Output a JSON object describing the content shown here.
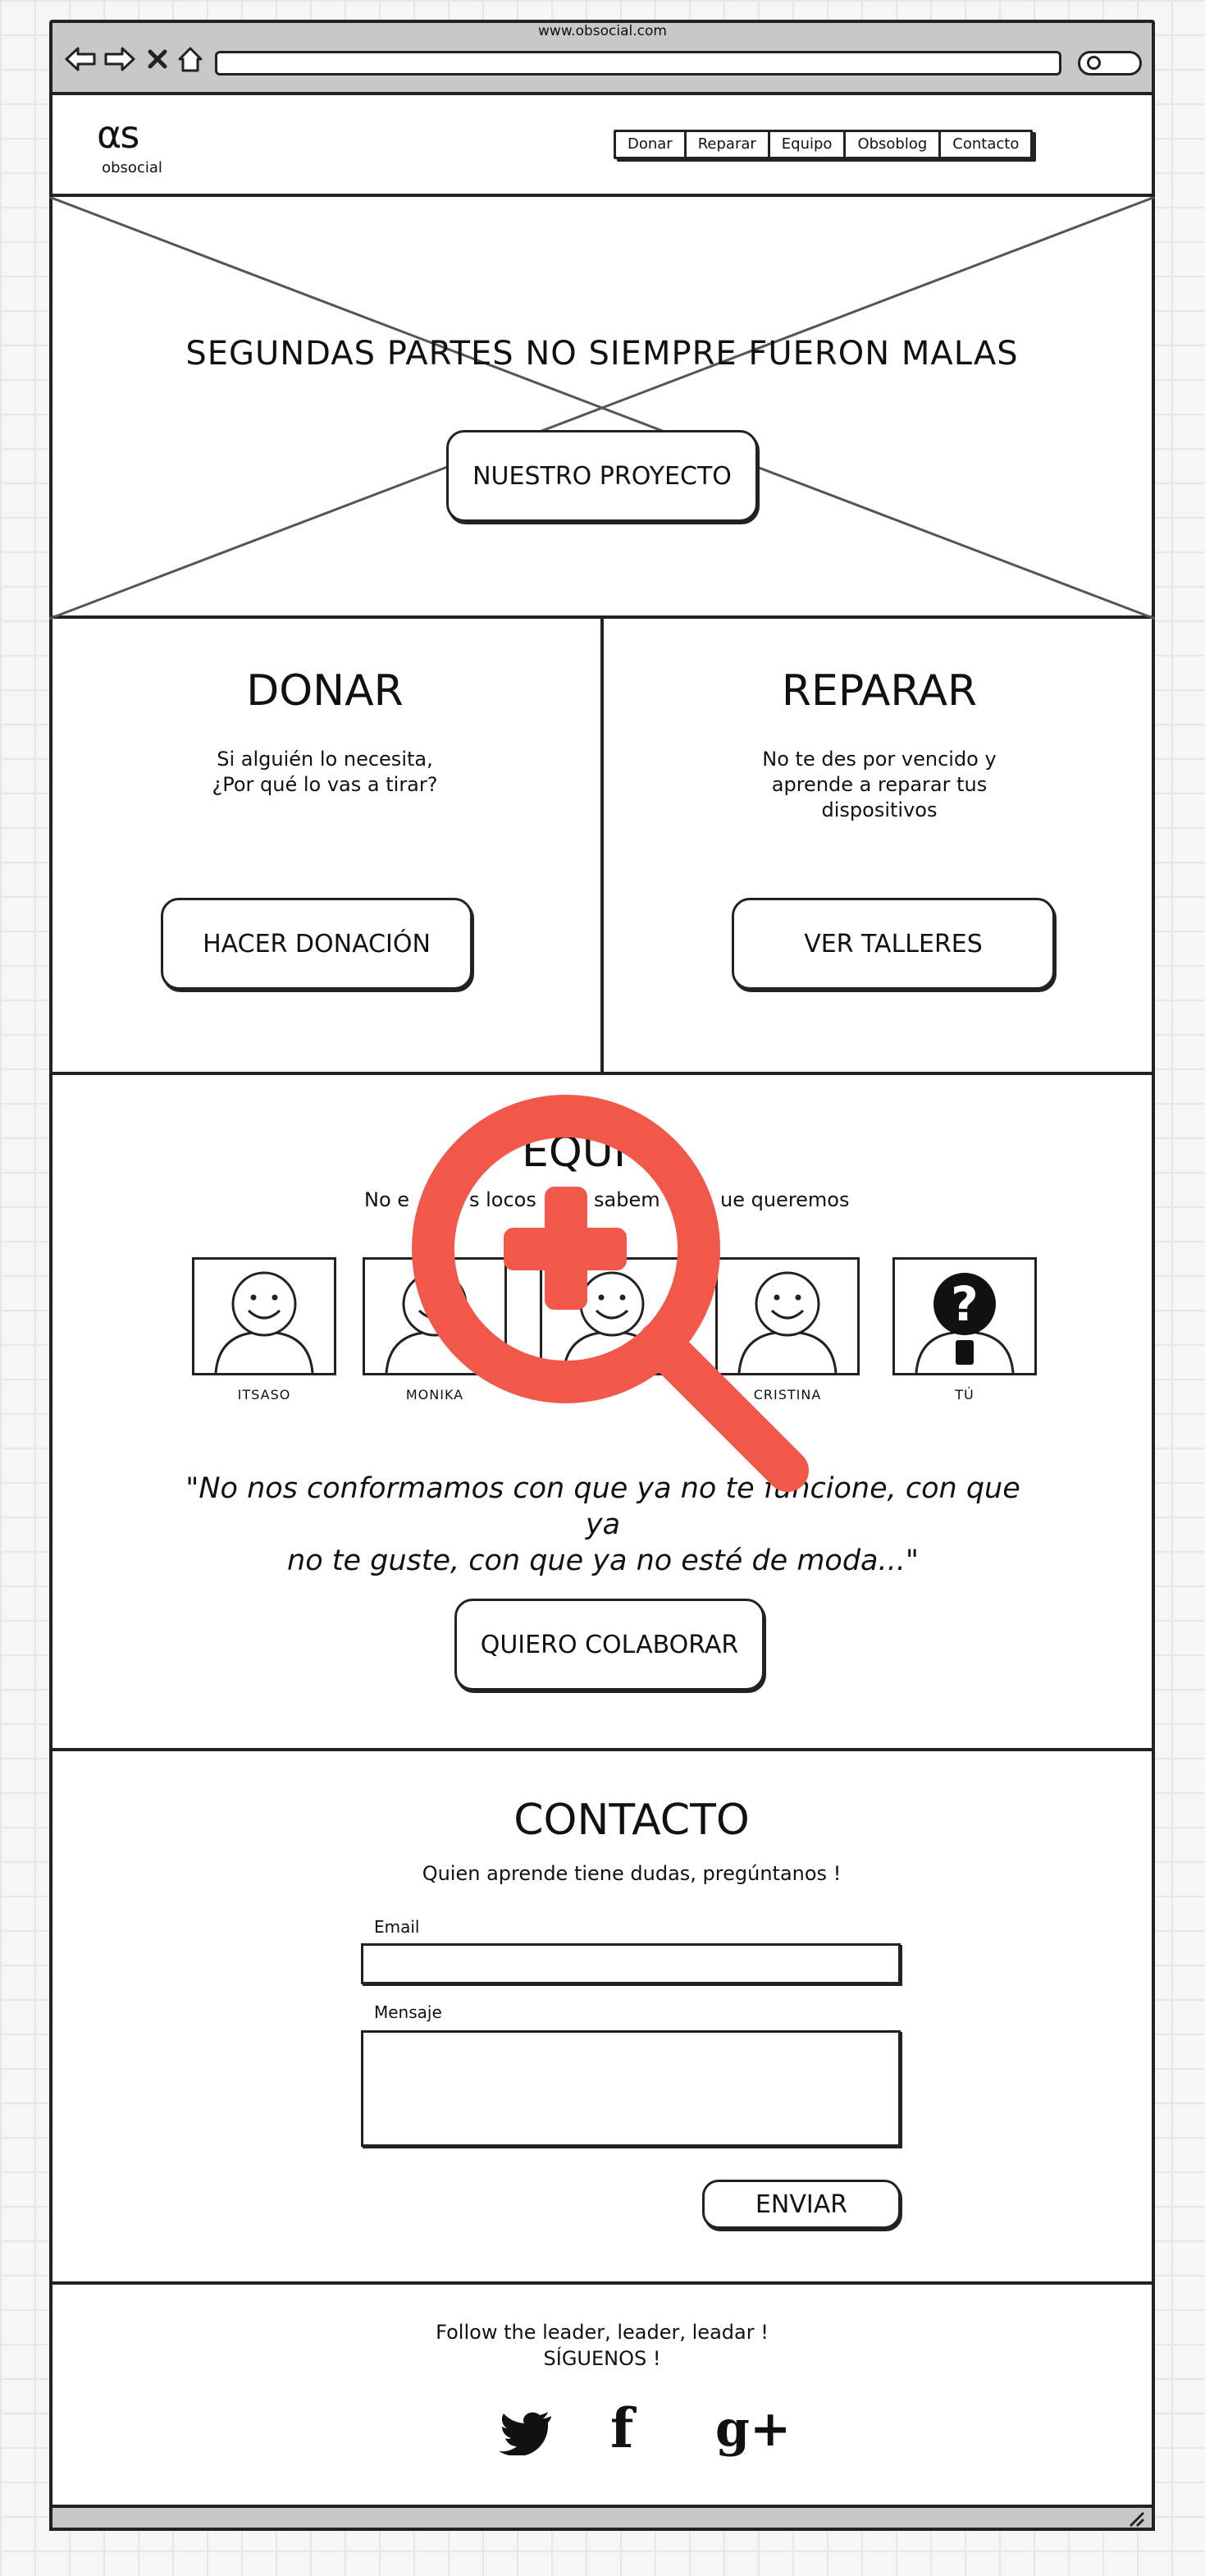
{
  "browser": {
    "url": "www.obsocial.com",
    "icons": [
      "back-icon",
      "forward-icon",
      "close-icon",
      "home-icon",
      "search-icon"
    ]
  },
  "header": {
    "logo_mark": "αs",
    "logo_text": "obsocial",
    "nav": [
      "Donar",
      "Reparar",
      "Equipo",
      "Obsoblog",
      "Contacto"
    ]
  },
  "hero": {
    "title": "SEGUNDAS PARTES NO SIEMPRE FUERON MALAS",
    "button": "NUESTRO PROYECTO"
  },
  "donar": {
    "title": "DONAR",
    "text_line1": "Si alguién lo necesita,",
    "text_line2": "¿Por qué lo vas a tirar?",
    "button": "HACER DONACIÓN"
  },
  "reparar": {
    "title": "REPARAR",
    "text_line1": "No te des por vencido y",
    "text_line2": "aprende a reparar tus",
    "text_line3": "dispositivos",
    "button": "VER TALLERES"
  },
  "equipo": {
    "title_visible": "EQUI",
    "subtitle_left": "No e",
    "subtitle_mid1": "s locos",
    "subtitle_mid2": "sabem",
    "subtitle_right": "ue queremos",
    "members": [
      {
        "name": "ITSASO",
        "avatar": "smiley"
      },
      {
        "name": "MONIKA",
        "avatar": "smiley"
      },
      {
        "name": "",
        "avatar": "smiley"
      },
      {
        "name": "CRISTINA",
        "avatar": "smiley"
      },
      {
        "name": "TÚ",
        "avatar": "question"
      }
    ],
    "quote_line1": "\"No nos conformamos con que ya no te funcione, con que ya",
    "quote_line2": "no te guste, con que ya no esté de moda...\"",
    "button": "QUIERO COLABORAR"
  },
  "contacto": {
    "title": "CONTACTO",
    "subtitle": "Quien aprende tiene dudas, pregúntanos !",
    "email_label": "Email",
    "message_label": "Mensaje",
    "button": "ENVIAR"
  },
  "footer": {
    "line1": "Follow the leader, leader, leadar !",
    "line2": "SÍGUENOS !",
    "social": [
      {
        "icon": "twitter-icon",
        "glyph": "🐦"
      },
      {
        "icon": "facebook-icon",
        "glyph": "f"
      },
      {
        "icon": "google-plus-icon",
        "glyph": "g+"
      }
    ]
  },
  "overlay": {
    "icon": "zoom-in-icon",
    "color": "#f2584a"
  }
}
